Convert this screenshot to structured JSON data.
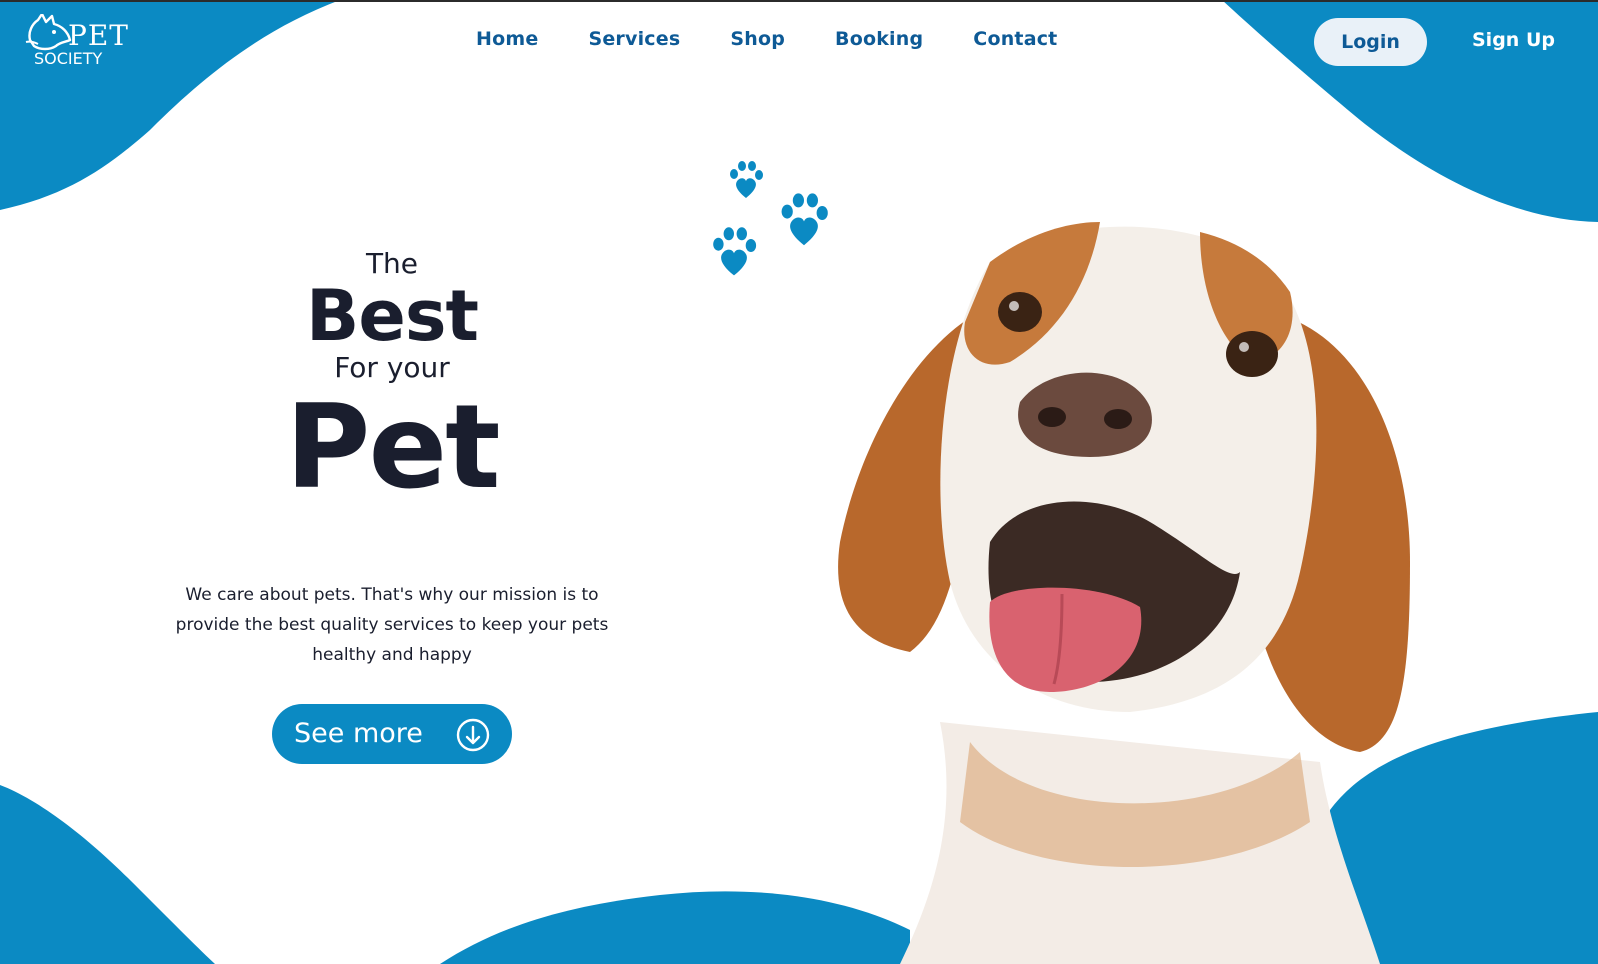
{
  "brand": {
    "logo_top": "PET",
    "logo_bottom": "SOCIETY"
  },
  "nav": {
    "items": [
      {
        "label": "Home"
      },
      {
        "label": "Services"
      },
      {
        "label": "Shop"
      },
      {
        "label": "Booking"
      },
      {
        "label": "Contact"
      }
    ]
  },
  "auth": {
    "login_label": "Login",
    "signup_label": "Sign Up"
  },
  "hero": {
    "line1": "The",
    "line2": "Best",
    "line3": "For your",
    "line4": "Pet",
    "description": "We care about pets. That's why our mission is to provide the best quality services to keep your pets healthy and happy",
    "cta_label": "See more",
    "cta_icon": "arrow-down-circle-icon"
  },
  "decor": {
    "paw_icon": "paw-heart-icon",
    "hero_image": "beagle-dog-photo"
  },
  "colors": {
    "brand_blue": "#0b8ac3",
    "nav_blue": "#0e5a96",
    "heading_dark": "#1a1e2e",
    "login_bg": "#e9f1f8",
    "background": "#ffffff"
  }
}
